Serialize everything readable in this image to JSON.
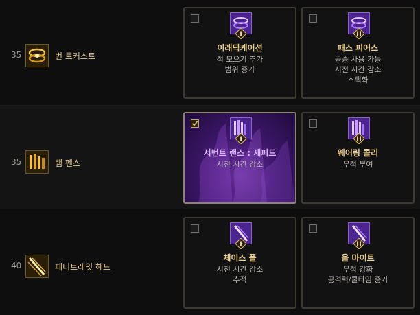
{
  "skills": [
    {
      "level": "35",
      "name": "번 로커스트",
      "icon": "burn-locust-icon",
      "talents": [
        {
          "selected": false,
          "tier": "I",
          "title": "이래딕케이션",
          "desc": [
            "적 모으기 추가",
            "범위 증가"
          ]
        },
        {
          "selected": false,
          "tier": "II",
          "title": "패스 피어스",
          "desc": [
            "공중 사용 가능",
            "시전 시간 감소",
            "스택화"
          ]
        }
      ]
    },
    {
      "level": "35",
      "name": "램 펜스",
      "icon": "ram-fence-icon",
      "talents": [
        {
          "selected": true,
          "tier": "I",
          "title": "서번트 랜스 : 세퍼드",
          "desc": [
            "시전 시간 감소"
          ]
        },
        {
          "selected": false,
          "tier": "II",
          "title": "웨어링 콜리",
          "desc": [
            "무적 부여"
          ]
        }
      ]
    },
    {
      "level": "40",
      "name": "페니트레잇 헤드",
      "icon": "penetrate-head-icon",
      "talents": [
        {
          "selected": false,
          "tier": "I",
          "title": "체이스 폴",
          "desc": [
            "시전 시간 감소",
            "추적"
          ]
        },
        {
          "selected": false,
          "tier": "II",
          "title": "올 마이트",
          "desc": [
            "무적 강화",
            "공격력/쿨타임 증가"
          ]
        }
      ]
    }
  ],
  "colors": {
    "accent_gold": "#e6c98c",
    "talent_purple": "#8a63c7",
    "selected_title": "#dcb4ff"
  }
}
